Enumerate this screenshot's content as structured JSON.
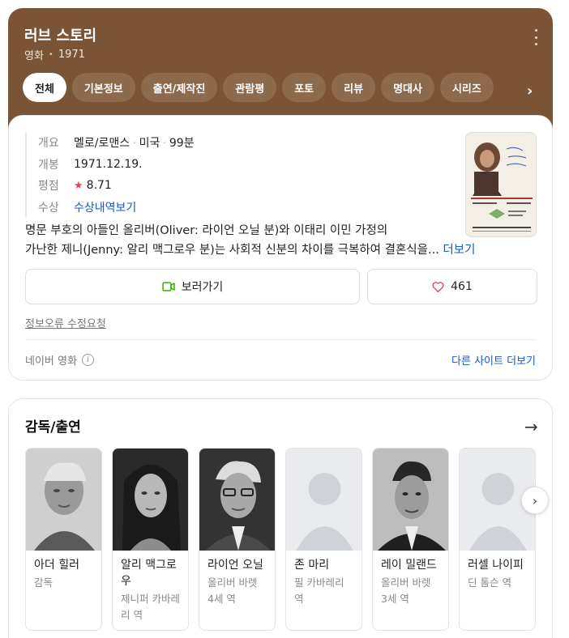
{
  "movie": {
    "title": "러브 스토리",
    "type": "영화",
    "year": "1971",
    "more_menu_icon": "more-vertical-icon"
  },
  "tabs": [
    {
      "label": "전체",
      "active": true
    },
    {
      "label": "기본정보"
    },
    {
      "label": "출연/제작진"
    },
    {
      "label": "관람평"
    },
    {
      "label": "포토"
    },
    {
      "label": "리뷰"
    },
    {
      "label": "명대사"
    },
    {
      "label": "시리즈"
    }
  ],
  "tabs_next_icon": "chevron-right-icon",
  "info": {
    "overview_label": "개요",
    "genre": "멜로/로맨스",
    "country": "미국",
    "runtime": "99분",
    "release_label": "개봉",
    "release_date": "1971.12.19.",
    "rating_label": "평점",
    "rating": "8.71",
    "awards_label": "수상",
    "awards_link": "수상내역보기",
    "synopsis_line1": "명문 부호의 아들인 올리버(Oliver: 라이언 오닐 분)와 이태리 이민 가정의",
    "synopsis_line2": "가난한 제니(Jenny: 알리 맥그로우 분)는 사회적 신분의 차이를 극복하여 결혼식을...",
    "more_label": "더보기",
    "watch_label": "보러가기",
    "like_count": "461",
    "report_label": "정보오류 수정요청",
    "source_label": "네이버 영화",
    "other_sites_label": "다른 사이트 더보기"
  },
  "cast": {
    "title": "감독/출연",
    "people": [
      {
        "name": "아더 힐러",
        "role": "감독",
        "photo": "portrait"
      },
      {
        "name": "알리 맥그로우",
        "role": "제니퍼 카바레리 역",
        "photo": "portrait"
      },
      {
        "name": "라이언 오닐",
        "role": "올리버 바렛 4세 역",
        "photo": "portrait"
      },
      {
        "name": "존 마리",
        "role": "필 카바레리 역",
        "photo": "placeholder"
      },
      {
        "name": "레이 밀랜드",
        "role": "올리버 바렛 3세 역",
        "photo": "portrait"
      },
      {
        "name": "러셀 나이피",
        "role": "딘 톰슨 역",
        "photo": "placeholder"
      }
    ]
  },
  "colors": {
    "header_bg": "#7a5434",
    "tab_bg": "#8e6a4c",
    "link": "#1a57c8",
    "star": "#e0455b",
    "watch_icon": "#2db400",
    "heart": "#e0455b"
  }
}
